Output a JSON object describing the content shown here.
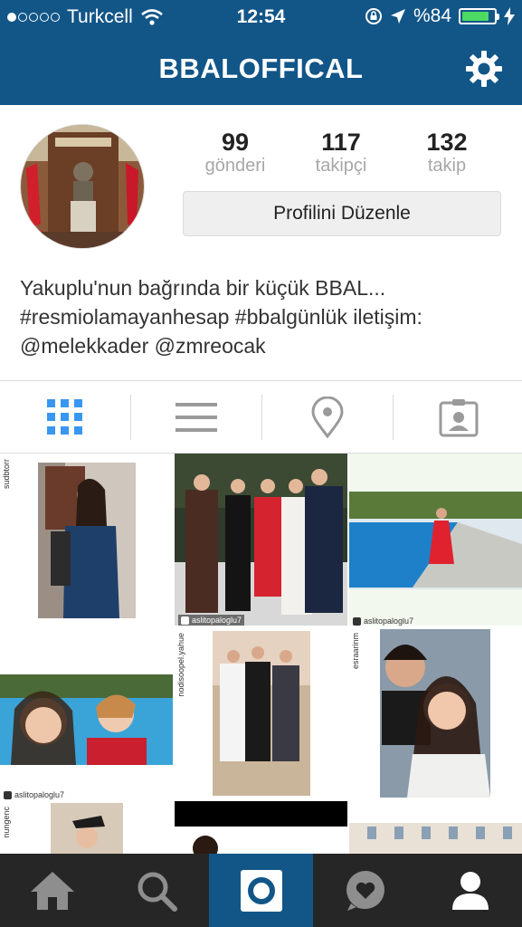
{
  "status_bar": {
    "carrier": "Turkcell",
    "time": "12:54",
    "battery_text": "%84",
    "battery_level": 0.84,
    "battery_color": "#4cd964"
  },
  "nav": {
    "title": "BBALOFFICAL",
    "settings_icon": "gear-icon",
    "bar_color": "#125688"
  },
  "profile": {
    "stats": [
      {
        "value": "99",
        "label": "gönderi"
      },
      {
        "value": "117",
        "label": "takipçi"
      },
      {
        "value": "132",
        "label": "takip"
      }
    ],
    "edit_button": "Profilini Düzenle",
    "bio": [
      "Yakuplu'nun bağrında bir küçük BBAL...",
      "#resmiolamayanhesap #bbalgünlük iletişim:",
      "@melekkader @zmreocak"
    ]
  },
  "view_tabs": [
    {
      "name": "grid-view-icon",
      "active": true
    },
    {
      "name": "list-view-icon",
      "active": false
    },
    {
      "name": "location-pin-icon",
      "active": false
    },
    {
      "name": "tagged-photos-icon",
      "active": false
    }
  ],
  "posts": {
    "credits": [
      "aslitopaloglu7",
      "aslitopaloglu7",
      "aslitopaloglu7"
    ]
  },
  "bottom_tabs": [
    {
      "name": "home-icon",
      "active": false
    },
    {
      "name": "search-icon",
      "active": false
    },
    {
      "name": "camera-icon",
      "active": true
    },
    {
      "name": "activity-heart-icon",
      "active": false
    },
    {
      "name": "profile-icon",
      "active": true
    }
  ]
}
